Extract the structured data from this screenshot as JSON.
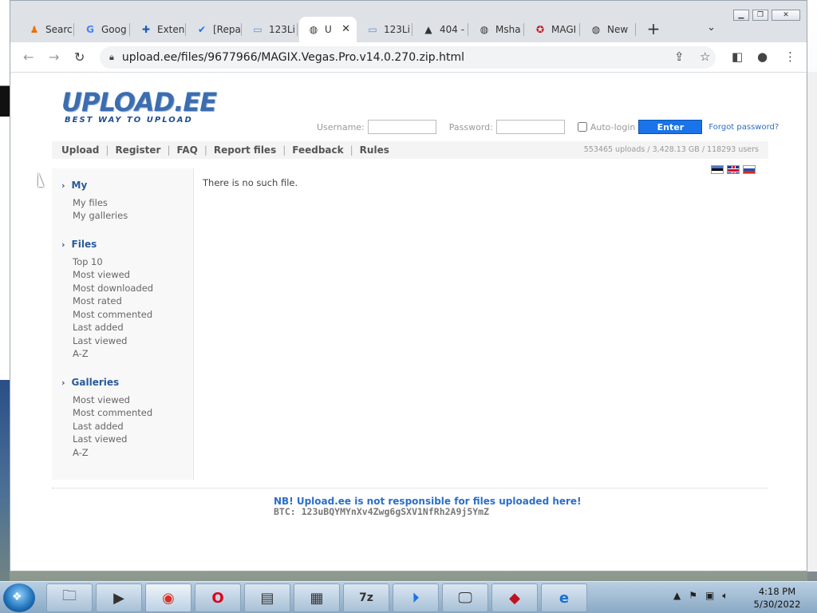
{
  "browser": {
    "tabs": [
      {
        "label": "Searc",
        "icon": "person-icon"
      },
      {
        "label": "Goog",
        "icon": "google-icon"
      },
      {
        "label": "Exten",
        "icon": "puzzle-icon"
      },
      {
        "label": "[Repa",
        "icon": "check-badge-icon"
      },
      {
        "label": "123Li",
        "icon": "link-icon"
      },
      {
        "label": "U",
        "icon": "globe-icon",
        "active": true
      },
      {
        "label": "123Li",
        "icon": "link-icon"
      },
      {
        "label": "404 -",
        "icon": "tent-icon"
      },
      {
        "label": "Msha",
        "icon": "globe-icon"
      },
      {
        "label": "MAGI",
        "icon": "magix-icon"
      },
      {
        "label": "New",
        "icon": "globe-icon"
      }
    ],
    "url": "upload.ee/files/9677966/MAGIX.Vegas.Pro.v14.0.270.zip.html"
  },
  "site": {
    "logo_main": "UPLOAD.EE",
    "logo_tagline": "BEST WAY TO UPLOAD",
    "login": {
      "username_label": "Username:",
      "password_label": "Password:",
      "autologin_label": "Auto-login",
      "enter_label": "Enter",
      "forgot_label": "Forgot password?"
    },
    "nav": [
      "Upload",
      "Register",
      "FAQ",
      "Report files",
      "Feedback",
      "Rules"
    ],
    "stats": "553465 uploads  /  3,428.13 GB  /  118293 users",
    "sidebar": {
      "my": {
        "title": "My",
        "items": [
          "My files",
          "My galleries"
        ]
      },
      "files": {
        "title": "Files",
        "items": [
          "Top 10",
          "Most viewed",
          "Most downloaded",
          "Most rated",
          "Most commented",
          "Last added",
          "Last viewed",
          "A-Z"
        ]
      },
      "galleries": {
        "title": "Galleries",
        "items": [
          "Most viewed",
          "Most commented",
          "Last added",
          "Last viewed",
          "A-Z"
        ]
      }
    },
    "message": "There is no such file.",
    "notice": "NB! Upload.ee is not responsible for files uploaded here!",
    "btc": "BTC: 123uBQYMYnXv4Zwg6gSXV1NfRh2A9j5YmZ"
  },
  "taskbar": {
    "clock_time": "4:18 PM",
    "clock_date": "5/30/2022"
  }
}
